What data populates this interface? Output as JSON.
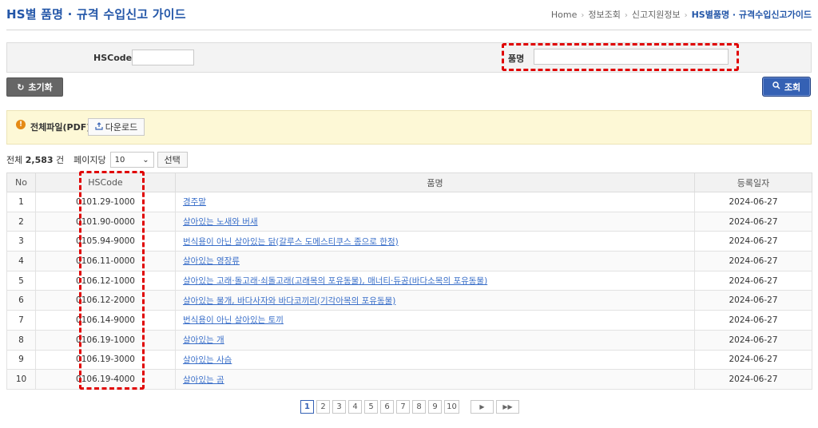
{
  "header": {
    "title": "HS별 품명 · 규격 수입신고 가이드",
    "breadcrumb": [
      "Home",
      "정보조회",
      "신고지원정보",
      "HS별품명 · 규격수입신고가이드"
    ]
  },
  "search": {
    "hscode_label": "HSCode",
    "hscode_value": "",
    "name_label": "품명",
    "name_value": "",
    "reset_label": "초기화",
    "search_label": "조회"
  },
  "notice": {
    "label": "전체파일(PDF)",
    "download_label": "다운로드"
  },
  "toolbar": {
    "total_prefix": "전체",
    "total_count": "2,583",
    "total_unit": "건",
    "per_page_label": "페이지당",
    "per_page_value": "10",
    "select_label": "선택"
  },
  "table": {
    "headers": [
      "No",
      "HSCode",
      "품명",
      "등록일자"
    ],
    "rows": [
      {
        "no": "1",
        "hscode": "0101.29-1000",
        "name": "경주말",
        "date": "2024-06-27"
      },
      {
        "no": "2",
        "hscode": "0101.90-0000",
        "name": "살아있는 노새와 버새",
        "date": "2024-06-27"
      },
      {
        "no": "3",
        "hscode": "0105.94-9000",
        "name": "번식용이 아닌 살아있는 닭(갈루스 도메스티쿠스 종으로 한정)",
        "date": "2024-06-27"
      },
      {
        "no": "4",
        "hscode": "0106.11-0000",
        "name": "살아있는 영장류",
        "date": "2024-06-27"
      },
      {
        "no": "5",
        "hscode": "0106.12-1000",
        "name": "살아있는 고래·돌고래·쇠돌고래(고래목의 포유동물), 매너티·듀공(바다소목의 포유동물)",
        "date": "2024-06-27"
      },
      {
        "no": "6",
        "hscode": "0106.12-2000",
        "name": "살아있는 물개, 바다사자와 바다코끼리(기각아목의 포유동물)",
        "date": "2024-06-27"
      },
      {
        "no": "7",
        "hscode": "0106.14-9000",
        "name": "번식용이 아닌 살아있는 토끼",
        "date": "2024-06-27"
      },
      {
        "no": "8",
        "hscode": "0106.19-1000",
        "name": "살아있는 개",
        "date": "2024-06-27"
      },
      {
        "no": "9",
        "hscode": "0106.19-3000",
        "name": "살아있는 사슴",
        "date": "2024-06-27"
      },
      {
        "no": "10",
        "hscode": "0106.19-4000",
        "name": "살아있는 곰",
        "date": "2024-06-27"
      }
    ]
  },
  "pagination": {
    "pages": [
      "1",
      "2",
      "3",
      "4",
      "5",
      "6",
      "7",
      "8",
      "9",
      "10"
    ],
    "current": "1",
    "next_icon": "next-page-icon",
    "last_icon": "last-page-icon"
  },
  "colors": {
    "accent": "#2356a8",
    "search_button": "#3561b4",
    "highlight": "#e00000",
    "notice_bg": "#fdf8d6"
  }
}
